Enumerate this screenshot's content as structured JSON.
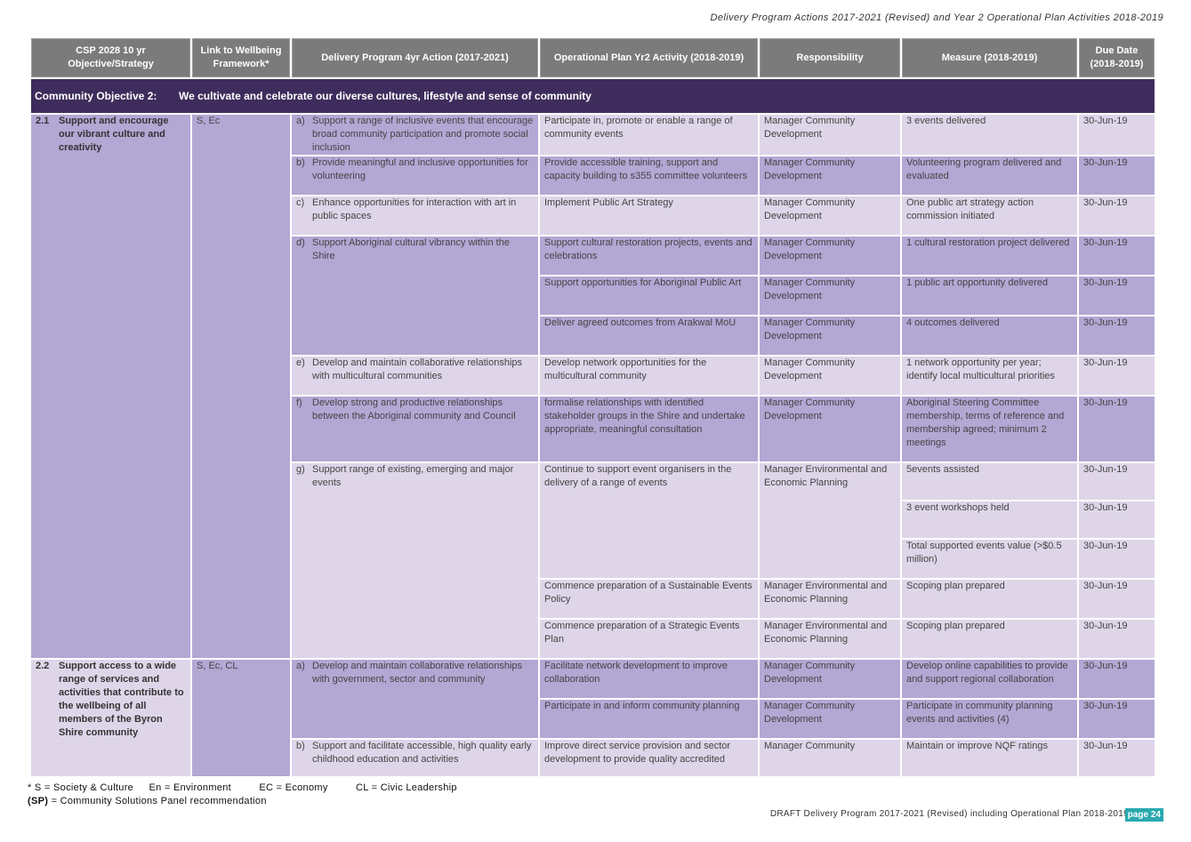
{
  "page_header": "Delivery Program Actions 2017-2021 (Revised) and Year 2 Operational Plan Activities 2018-2019",
  "columns": [
    "CSP 2028 10 yr Objective/Strategy",
    "Link to Wellbeing Framework*",
    "Delivery Program 4yr Action (2017-2021)",
    "Operational Plan Yr2 Activity (2018-2019)",
    "Responsibility",
    "Measure (2018-2019)",
    "Due Date (2018-2019)"
  ],
  "objective": {
    "label": "Community Objective 2:",
    "text": "We cultivate and celebrate our diverse cultures, lifestyle and sense of community"
  },
  "strategies": [
    {
      "num": "2.1",
      "title": "Support and encourage our vibrant culture and creativity",
      "link": "S, Ec",
      "actions": [
        {
          "letter": "a)",
          "text": "Support a range of inclusive events that encourage broad community participation and promote social inclusion"
        },
        {
          "letter": "b)",
          "text": "Provide meaningful and inclusive opportunities for volunteering"
        },
        {
          "letter": "c)",
          "text": "Enhance opportunities for interaction with art in public spaces"
        },
        {
          "letter": "d)",
          "text": "Support Aboriginal cultural vibrancy within the Shire"
        },
        {
          "letter": "e)",
          "text": "Develop and maintain collaborative relationships with multicultural communities"
        },
        {
          "letter": "f)",
          "text": "Develop strong and productive relationships between the Aboriginal community and Council"
        },
        {
          "letter": "g)",
          "text": "Support range of existing, emerging and major events"
        }
      ],
      "activities": [
        {
          "activity": "Participate in, promote or enable a range of community events",
          "responsibility": "Manager Community Development",
          "measure": "3 events delivered",
          "due": "30-Jun-19"
        },
        {
          "activity": "Provide accessible training, support and capacity building to s355 committee volunteers",
          "responsibility": "Manager Community Development",
          "measure": "Volunteering program delivered and evaluated",
          "due": "30-Jun-19"
        },
        {
          "activity": "Implement Public Art Strategy",
          "responsibility": "Manager Community Development",
          "measure": "One public art strategy action commission initiated",
          "due": "30-Jun-19"
        },
        {
          "activity": "Support cultural restoration projects, events and celebrations",
          "responsibility": "Manager Community Development",
          "measure": "1 cultural restoration project delivered",
          "due": "30-Jun-19"
        },
        {
          "activity": "Support opportunities for Aboriginal Public Art",
          "responsibility": "Manager Community Development",
          "measure": "1 public art opportunity delivered",
          "due": "30-Jun-19"
        },
        {
          "activity": "Deliver agreed outcomes from Arakwal MoU",
          "responsibility": "Manager Community Development",
          "measure": "4 outcomes delivered",
          "due": "30-Jun-19"
        },
        {
          "activity": "Develop network opportunities for the multicultural community",
          "responsibility": "Manager Community Development",
          "measure": "1 network opportunity per year; identify local multicultural priorities",
          "due": "30-Jun-19"
        },
        {
          "activity": "formalise relationships with identified stakeholder groups in the Shire and undertake appropriate, meaningful consultation",
          "responsibility": "Manager Community Development",
          "measure": "Aboriginal Steering Committee membership, terms of reference and membership agreed; minimum 2 meetings",
          "due": "30-Jun-19"
        },
        {
          "activity": "Continue to support event organisers in the delivery of a range of events",
          "responsibility": "Manager Environmental and Economic Planning",
          "measures": [
            {
              "measure": "5events assisted",
              "due": "30-Jun-19"
            },
            {
              "measure": "3 event workshops held",
              "due": "30-Jun-19"
            },
            {
              "measure": "Total supported events value (>$0.5 million)",
              "due": "30-Jun-19"
            }
          ]
        },
        {
          "activity": "Commence preparation of a Sustainable Events Policy",
          "responsibility": "Manager Environmental and Economic Planning",
          "measure": "Scoping plan prepared",
          "due": "30-Jun-19"
        },
        {
          "activity": "Commence preparation of a Strategic Events Plan",
          "responsibility": "Manager Environmental and Economic Planning",
          "measure": "Scoping plan prepared",
          "due": "30-Jun-19"
        }
      ]
    },
    {
      "num": "2.2",
      "title": "Support access to a wide range of services and activities that contribute to the wellbeing of all members of the Byron Shire community",
      "link": "S, Ec, CL",
      "actions": [
        {
          "letter": "a)",
          "text": "Develop and maintain collaborative relationships with government, sector and community"
        },
        {
          "letter": "b)",
          "text": "Support and facilitate accessible, high quality early childhood education and activities"
        }
      ],
      "activities": [
        {
          "activity": "Facilitate network development to improve collaboration",
          "responsibility": "Manager Community Development",
          "measure": "Develop online capabilities to provide and support regional collaboration",
          "due": "30-Jun-19"
        },
        {
          "activity": "Participate in and inform community planning",
          "responsibility": "Manager Community Development",
          "measure": "Participate in community planning events and activities (4)",
          "due": "30-Jun-19"
        },
        {
          "activity": "Improve direct service provision and sector development to provide quality accredited",
          "responsibility": "Manager Community",
          "measure": "Maintain or improve NQF ratings",
          "due": "30-Jun-19"
        }
      ]
    }
  ],
  "footnotes": {
    "legend": [
      "* S = Society & Culture",
      "En = Environment",
      "EC = Economy",
      "CL = Civic Leadership"
    ],
    "sp_tag": "(SP)",
    "sp_text": "= Community Solutions Panel recommendation"
  },
  "footer": {
    "text": "DRAFT Delivery Program 2017-2021 (Revised) including Operational Plan 2018-2019",
    "page": "page 24"
  },
  "colors": {
    "header_grey": "#7b7b7b",
    "objective_band": "#3e2d5c",
    "lavender_medium": "#b3a7d4",
    "lavender_light": "#ded5e9",
    "page_badge": "#2aa9b0"
  }
}
